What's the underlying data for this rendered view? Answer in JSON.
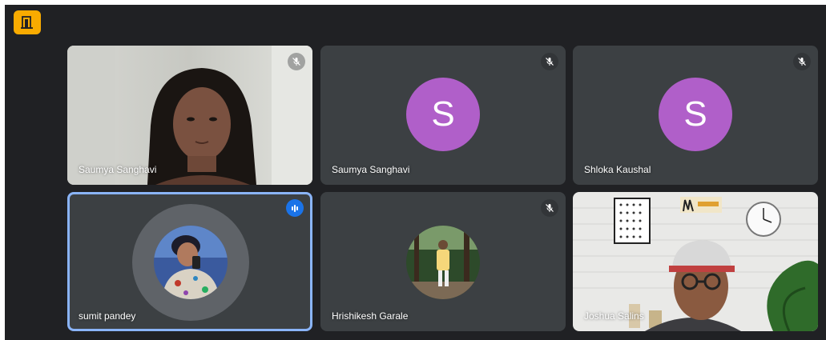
{
  "meeting": {
    "participants": [
      {
        "name": "Saumya Sanghavi",
        "video": true,
        "muted": true
      },
      {
        "name": "Saumya Sanghavi",
        "video": false,
        "muted": true,
        "initial": "S"
      },
      {
        "name": "Shloka Kaushal",
        "video": false,
        "muted": true,
        "initial": "S"
      },
      {
        "name": "sumit pandey",
        "video": false,
        "muted": false,
        "speaking": true,
        "active": true
      },
      {
        "name": "Hrishikesh Garale",
        "video": false,
        "muted": true
      },
      {
        "name": "Joshua Salins",
        "video": true,
        "muted": false
      }
    ]
  },
  "icons": {
    "app": "door-exit-icon",
    "muted": "mic-off-icon",
    "speaking": "audio-level-icon"
  },
  "colors": {
    "background": "#202124",
    "tile": "#3c4043",
    "avatar_purple": "#b05fc9",
    "active_border": "#8ab4f8",
    "speaking_blue": "#1a73e8",
    "app_icon": "#f9ab00"
  }
}
